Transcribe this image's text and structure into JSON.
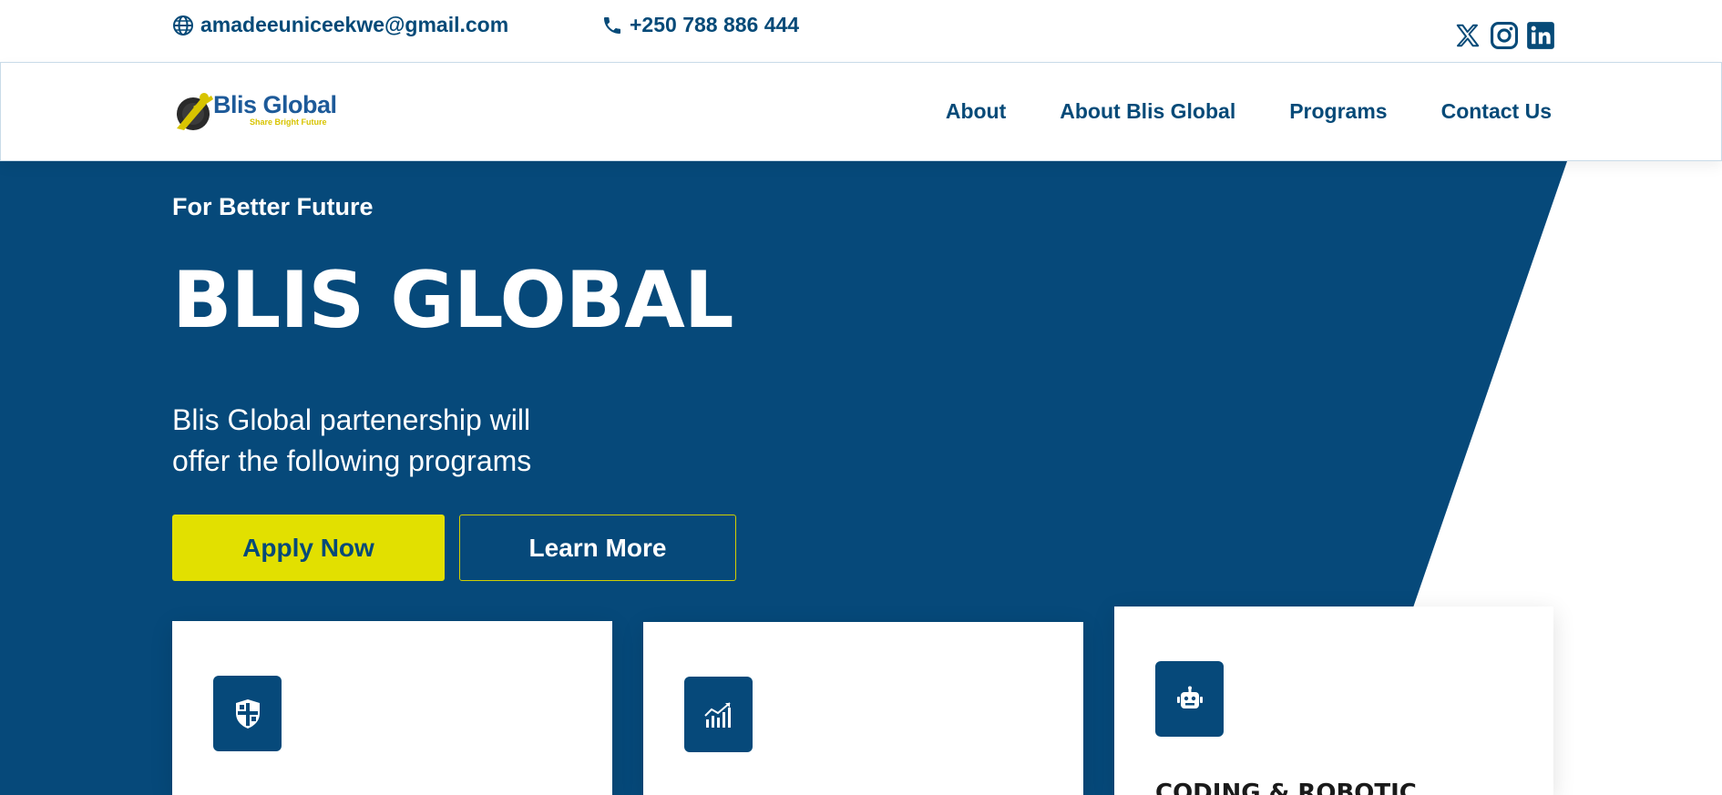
{
  "topbar": {
    "email": "amadeeuniceekwe@gmail.com",
    "phone": "+250 788 886 444",
    "socials": [
      "x-icon",
      "instagram-icon",
      "linkedin-icon"
    ]
  },
  "header": {
    "logo_name": "Blis Global",
    "logo_tagline": "Share Bright Future",
    "nav": [
      "About",
      "About Blis Global",
      "Programs",
      "Contact Us"
    ]
  },
  "hero": {
    "eyebrow": "For Better Future",
    "title": "BLIS GLOBAL",
    "subtitle": "Blis Global partenership will offer the following programs",
    "apply_label": "Apply Now",
    "learn_label": "Learn More"
  },
  "cards": [
    {
      "icon": "shield-icon",
      "title": ""
    },
    {
      "icon": "chart-growth-icon",
      "title": ""
    },
    {
      "icon": "robot-icon",
      "title": "CODING & ROBOTIC"
    }
  ],
  "colors": {
    "primary": "#06497a",
    "accent": "#e2e000",
    "white": "#ffffff"
  }
}
